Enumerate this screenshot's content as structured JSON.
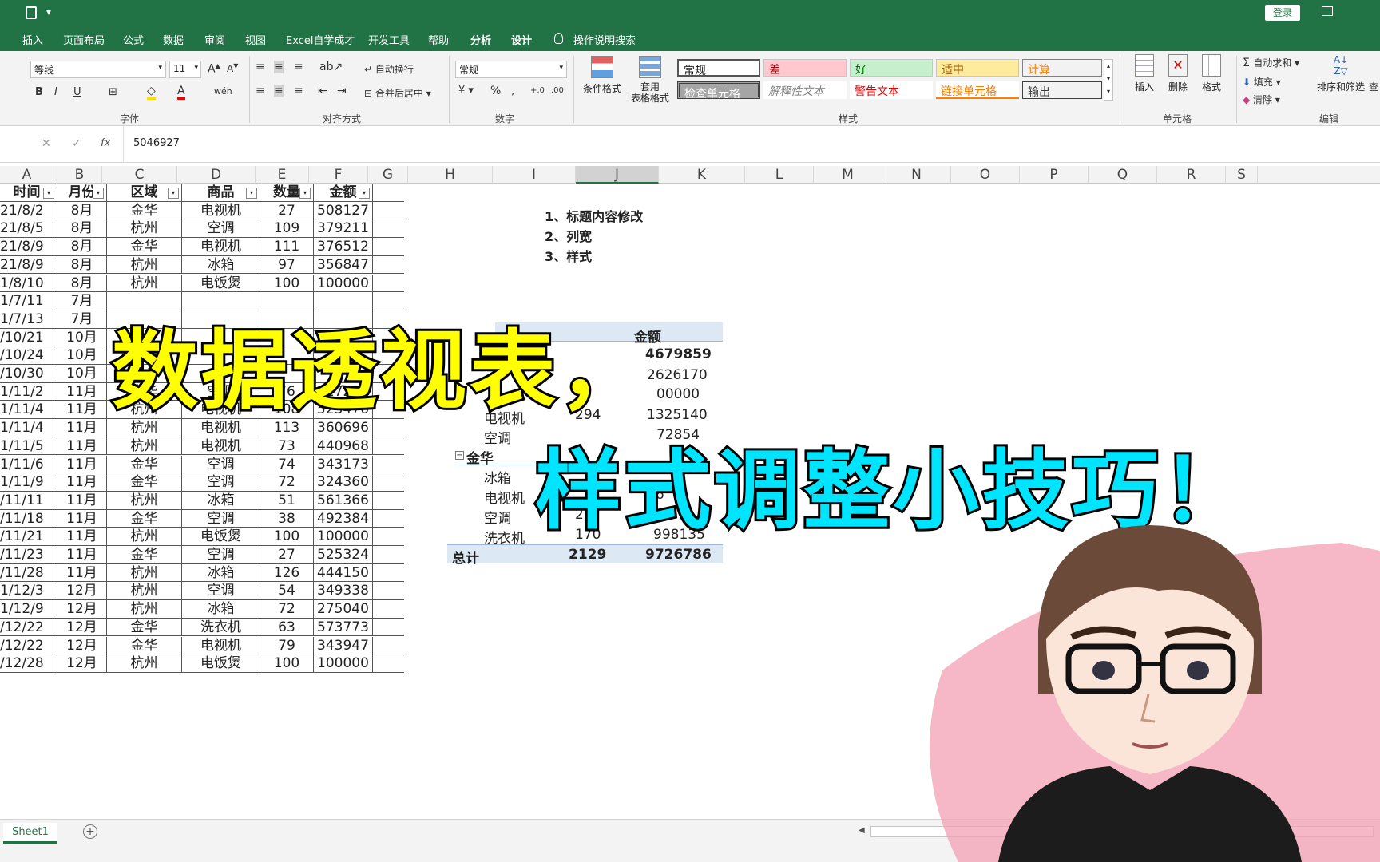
{
  "titlebar": {
    "login": "登录"
  },
  "menu": {
    "tabs": [
      "插入",
      "页面布局",
      "公式",
      "数据",
      "审阅",
      "视图",
      "Excel自学成才",
      "开发工具",
      "帮助",
      "分析",
      "设计"
    ],
    "help_search": "操作说明搜索"
  },
  "ribbon": {
    "font": {
      "name": "等线",
      "size": "11",
      "group_label": "字体",
      "wrap": "自动换行",
      "merge": "合并后居中"
    },
    "align": {
      "group_label": "对齐方式"
    },
    "number": {
      "format": "常规",
      "group_label": "数字"
    },
    "cond_format": "条件格式",
    "table_format": "套用\n表格格式",
    "styles": {
      "group_label": "样式",
      "normal": "常规",
      "bad": "差",
      "good": "好",
      "neutral": "适中",
      "calc": "计算",
      "check": "检查单元格",
      "explain": "解释性文本",
      "warn": "警告文本",
      "link": "链接单元格",
      "output": "输出"
    },
    "cells": {
      "group_label": "单元格",
      "insert": "插入",
      "delete": "删除",
      "format": "格式"
    },
    "edit": {
      "group_label": "编辑",
      "autosum": "自动求和",
      "fill": "填充",
      "clear": "清除",
      "sort": "排序和筛选",
      "find": "查"
    }
  },
  "formula": {
    "value": "5046927",
    "fx": "fx"
  },
  "columns": [
    "A",
    "B",
    "C",
    "D",
    "E",
    "F",
    "G",
    "H",
    "I",
    "J",
    "K",
    "L",
    "M",
    "N",
    "O",
    "P",
    "Q",
    "R",
    "S"
  ],
  "table": {
    "headers": [
      "时间",
      "月份",
      "区域",
      "商品",
      "数量",
      "金额"
    ],
    "rows": [
      [
        "21/8/2",
        "8月",
        "金华",
        "电视机",
        "27",
        "508127"
      ],
      [
        "21/8/5",
        "8月",
        "杭州",
        "空调",
        "109",
        "379211"
      ],
      [
        "21/8/9",
        "8月",
        "金华",
        "电视机",
        "111",
        "376512"
      ],
      [
        "21/8/9",
        "8月",
        "杭州",
        "冰箱",
        "97",
        "356847"
      ],
      [
        "1/8/10",
        "8月",
        "杭州",
        "电饭煲",
        "100",
        "100000"
      ],
      [
        "1/7/11",
        "7月",
        "",
        "",
        "",
        ""
      ],
      [
        "1/7/13",
        "7月",
        "",
        "",
        "",
        ""
      ],
      [
        "/10/21",
        "10月",
        "",
        "",
        "",
        ""
      ],
      [
        "/10/24",
        "10月",
        "",
        "",
        "",
        ""
      ],
      [
        "/10/30",
        "10月",
        "",
        "",
        "",
        ""
      ],
      [
        "1/11/2",
        "11月",
        "金华",
        "空调",
        "76",
        "427266"
      ],
      [
        "1/11/4",
        "11月",
        "杭州",
        "电视机",
        "108",
        "523476"
      ],
      [
        "1/11/4",
        "11月",
        "杭州",
        "电视机",
        "113",
        "360696"
      ],
      [
        "1/11/5",
        "11月",
        "杭州",
        "电视机",
        "73",
        "440968"
      ],
      [
        "1/11/6",
        "11月",
        "金华",
        "空调",
        "74",
        "343173"
      ],
      [
        "1/11/9",
        "11月",
        "金华",
        "空调",
        "72",
        "324360"
      ],
      [
        "/11/11",
        "11月",
        "杭州",
        "冰箱",
        "51",
        "561366"
      ],
      [
        "/11/18",
        "11月",
        "金华",
        "空调",
        "38",
        "492384"
      ],
      [
        "/11/21",
        "11月",
        "杭州",
        "电饭煲",
        "100",
        "100000"
      ],
      [
        "/11/23",
        "11月",
        "金华",
        "空调",
        "27",
        "525324"
      ],
      [
        "/11/28",
        "11月",
        "杭州",
        "冰箱",
        "126",
        "444150"
      ],
      [
        "1/12/3",
        "12月",
        "杭州",
        "空调",
        "54",
        "349338"
      ],
      [
        "1/12/9",
        "12月",
        "杭州",
        "冰箱",
        "72",
        "275040"
      ],
      [
        "/12/22",
        "12月",
        "金华",
        "洗衣机",
        "63",
        "573773"
      ],
      [
        "/12/22",
        "12月",
        "金华",
        "电视机",
        "79",
        "343947"
      ],
      [
        "/12/28",
        "12月",
        "杭州",
        "电饭煲",
        "100",
        "100000"
      ]
    ]
  },
  "notes": [
    "1、标题内容修改",
    "2、列宽",
    "3、样式"
  ],
  "pivot": {
    "header_amount": "金额",
    "first_total": "4679859",
    "v2": "2626170",
    "v3": "00000",
    "r_tv": "电视机",
    "r_tv_qty": "294",
    "r_tv_amt": "1325140",
    "r_ac": "空调",
    "r_ac_amt": "72854",
    "group2": "金华",
    "g2_fridge": "冰箱",
    "g2_tv": "电视机",
    "g2_tv_amt": "16",
    "g2_ac": "空调",
    "g2_ac_qty": "287",
    "g2_wm": "洗衣机",
    "g2_wm_qty": "170",
    "g2_wm_amt": "998135",
    "total_label": "总计",
    "total_qty": "2129",
    "total_amt": "9726786"
  },
  "overlay": {
    "line1": "数据透视表，",
    "line2": "样式调整小技巧！"
  },
  "status": {
    "sheet": "Sheet1"
  }
}
